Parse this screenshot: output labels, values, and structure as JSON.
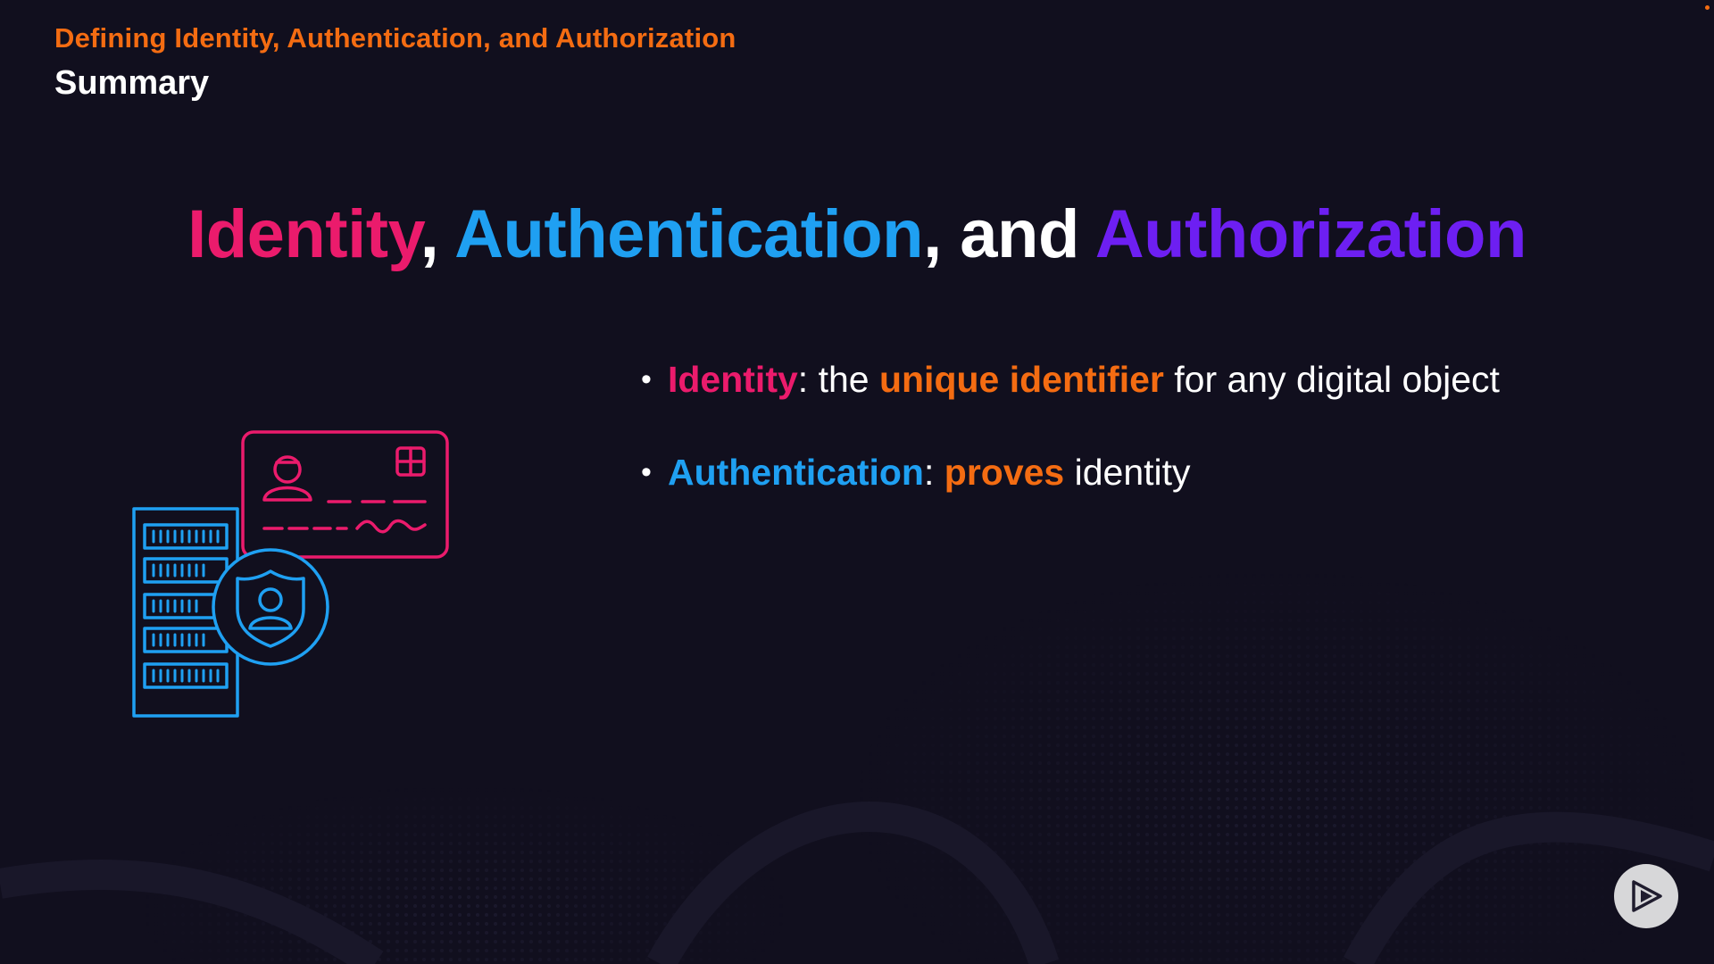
{
  "header": {
    "course_title": "Defining Identity, Authentication, and Authorization",
    "section_title": "Summary"
  },
  "slide": {
    "heading": {
      "part1": "Identity",
      "sep1": ", ",
      "part2": "Authentication",
      "sep2": ", and ",
      "part3": "Authorization"
    },
    "bullets": [
      {
        "term": "Identity",
        "colon": ": the ",
        "highlight": "unique identifier",
        "rest": " for any digital object"
      },
      {
        "term": "Authentication",
        "colon": ": ",
        "highlight": "proves",
        "rest": " identity"
      }
    ],
    "bullet_glyph": "•"
  },
  "icons": {
    "illustration": "id-card-server-shield-icon",
    "logo": "play-logo-icon"
  },
  "colors": {
    "background": "#110f1e",
    "orange": "#f46c12",
    "pink": "#eb1b6c",
    "blue": "#1fa0f2",
    "purple": "#6d1ff2",
    "white": "#ffffff"
  }
}
